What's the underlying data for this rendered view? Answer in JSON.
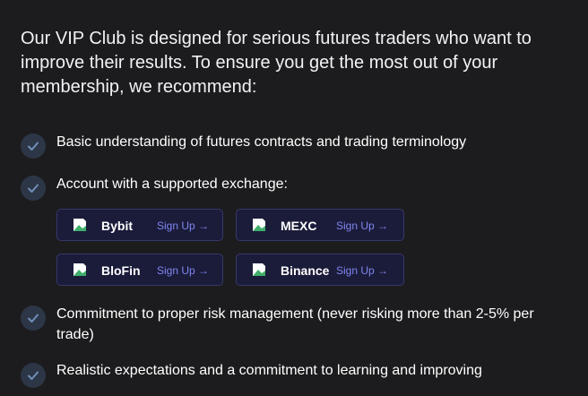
{
  "intro": "Our VIP Club is designed for serious futures traders who want to improve their results. To ensure you get the most out of your membership, we recommend:",
  "requirements": [
    {
      "text": "Basic understanding of futures contracts and trading terminology"
    },
    {
      "text": "Account with a supported exchange:"
    },
    {
      "text": "Commitment to proper risk management (never risking more than 2-5% per trade)"
    },
    {
      "text": "Realistic expectations and a commitment to learning and improving"
    }
  ],
  "exchanges": [
    {
      "name": "Bybit",
      "cta": "Sign Up →"
    },
    {
      "name": "MEXC",
      "cta": "Sign Up →"
    },
    {
      "name": "BloFin",
      "cta": "Sign Up →"
    },
    {
      "name": "Binance",
      "cta": "Sign Up →"
    }
  ],
  "colors": {
    "background": "#1c1c1e",
    "check_circle": "#2d3647",
    "check_mark": "#6f8fb8",
    "button_bg": "#1b1c3a",
    "button_border": "#35386a",
    "cta_text": "#7f86f0"
  }
}
